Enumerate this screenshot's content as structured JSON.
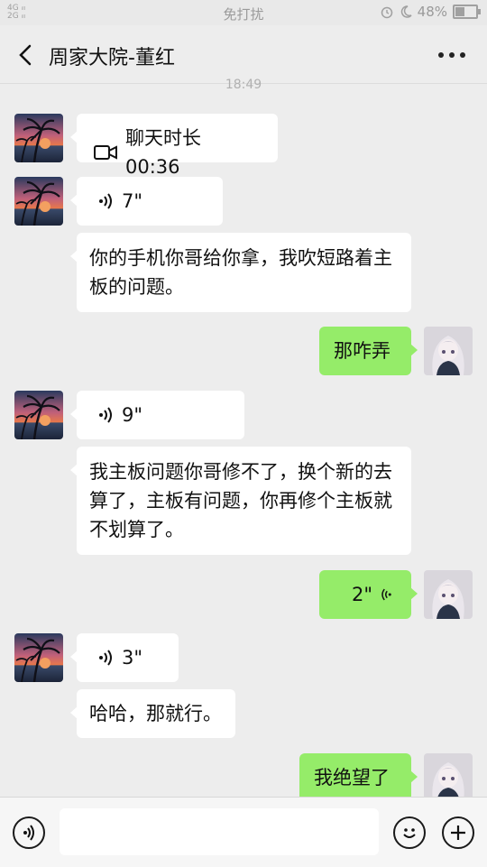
{
  "statusbar": {
    "network": "4G 2G",
    "dnd": "免打扰",
    "battery": "48%",
    "battery_level": 0.48
  },
  "header": {
    "title": "周家大院-董红"
  },
  "chat": {
    "timestamp": "18:49",
    "messages": [
      {
        "side": "left",
        "type": "video_call",
        "text": "聊天时长 00:36"
      },
      {
        "side": "left",
        "type": "voice",
        "text": "7\""
      },
      {
        "side": "left",
        "type": "text",
        "text": "你的手机你哥给你拿，我吹短路着主板的问题。"
      },
      {
        "side": "right",
        "type": "text",
        "text": "那咋弄"
      },
      {
        "side": "left",
        "type": "voice",
        "text": "9\""
      },
      {
        "side": "left",
        "type": "text",
        "text": "我主板问题你哥修不了，换个新的去算了，主板有问题，你再修个主板就不划算了。"
      },
      {
        "side": "right",
        "type": "voice",
        "text": "2\""
      },
      {
        "side": "left",
        "type": "voice",
        "text": "3\""
      },
      {
        "side": "left",
        "type": "text",
        "text": "哈哈，那就行。"
      },
      {
        "side": "right",
        "type": "text",
        "text": "我绝望了"
      }
    ]
  },
  "inputbar": {
    "placeholder": ""
  },
  "colors": {
    "background": "#ededed",
    "bubble_self": "#95ec69",
    "bubble_other": "#ffffff"
  }
}
